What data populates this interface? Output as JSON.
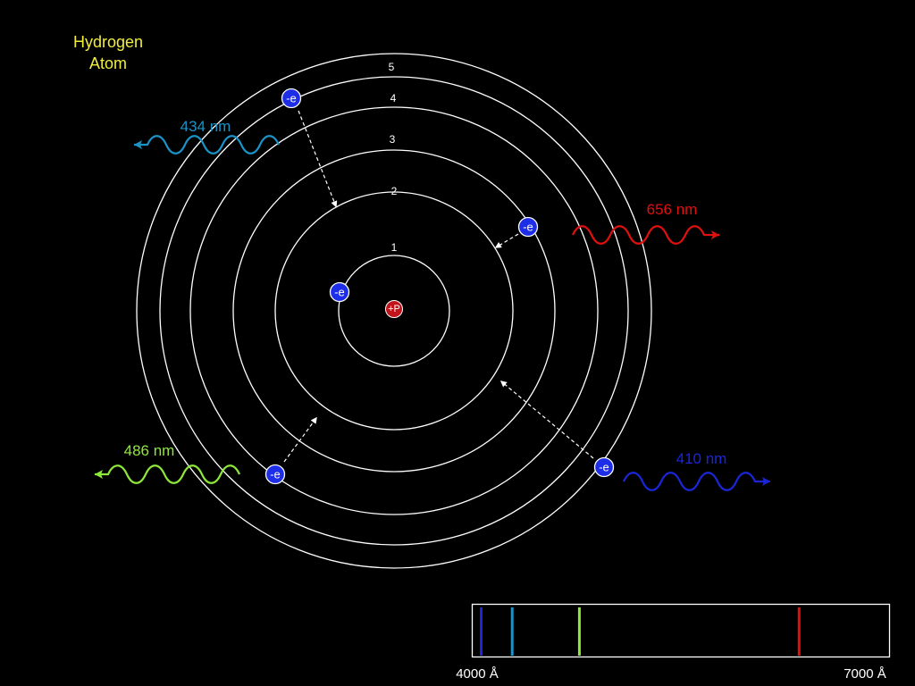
{
  "title": {
    "line1": "Hydrogen",
    "line2": "Atom",
    "color": "#f0ee3c"
  },
  "nucleus": {
    "label": "+P",
    "color": "#c0141a"
  },
  "orbits": [
    {
      "n": 1,
      "label": "1"
    },
    {
      "n": 2,
      "label": "2"
    },
    {
      "n": 3,
      "label": "3"
    },
    {
      "n": 4,
      "label": "4"
    },
    {
      "n": 5,
      "label": "5"
    }
  ],
  "electron": {
    "label": "-e",
    "color": "#1e2ee8"
  },
  "transitions": [
    {
      "from": 5,
      "to": 2,
      "wavelength_label": "434 nm",
      "color": "#1a93c8"
    },
    {
      "from": 3,
      "to": 2,
      "wavelength_label": "656 nm",
      "color": "#e01010"
    },
    {
      "from": 4,
      "to": 2,
      "wavelength_label": "486 nm",
      "color": "#8ee83a"
    },
    {
      "from": 6,
      "to": 2,
      "wavelength_label": "410 nm",
      "color": "#1a26d8"
    }
  ],
  "spectrum": {
    "min_label": "4000 Å",
    "max_label": "7000 Å",
    "range_angstrom": [
      4000,
      7000
    ],
    "lines": [
      {
        "wavelength_nm": 410,
        "color": "#1a26d8"
      },
      {
        "wavelength_nm": 434,
        "color": "#1a93c8"
      },
      {
        "wavelength_nm": 486,
        "color": "#8ee83a"
      },
      {
        "wavelength_nm": 656,
        "color": "#e01010"
      }
    ]
  }
}
